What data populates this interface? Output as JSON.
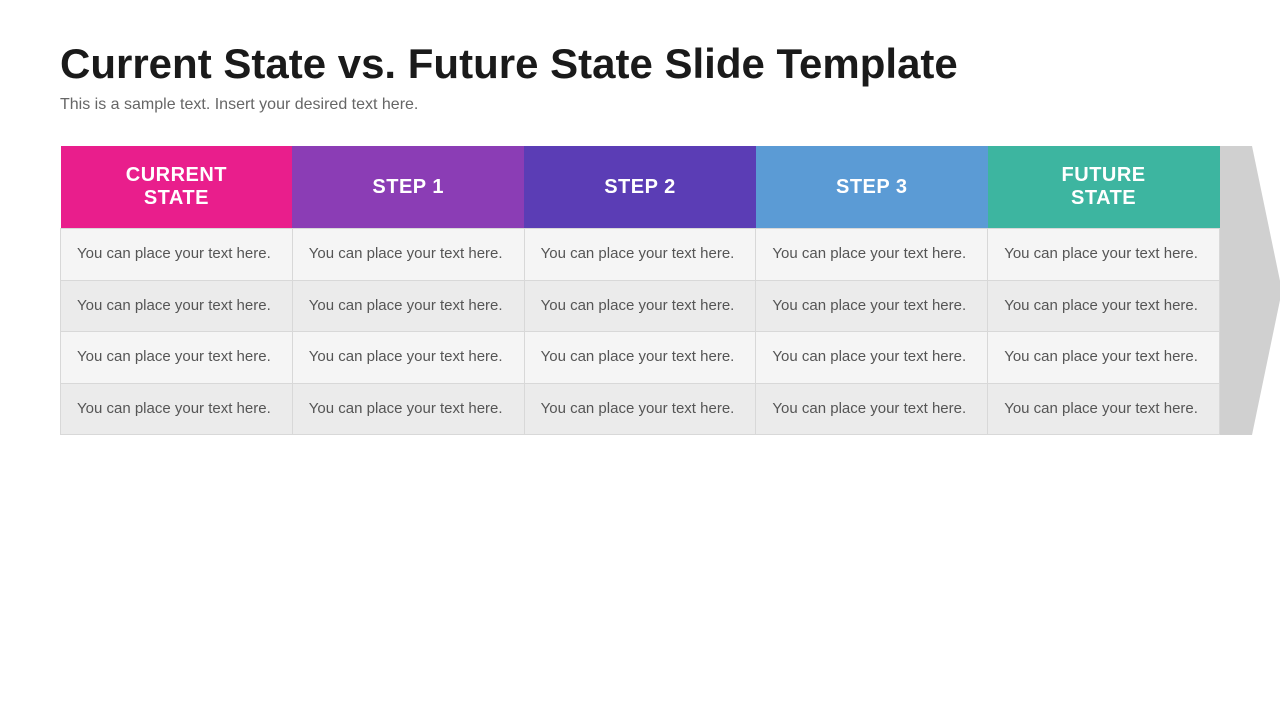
{
  "header": {
    "title": "Current State vs. Future State Slide Template",
    "subtitle": "This is a sample text. Insert your desired text here."
  },
  "table": {
    "columns": [
      {
        "id": "current",
        "label": "CURRENT\nSTATE",
        "class": "col-current"
      },
      {
        "id": "step1",
        "label": "STEP 1",
        "class": "col-step1"
      },
      {
        "id": "step2",
        "label": "STEP 2",
        "class": "col-step2"
      },
      {
        "id": "step3",
        "label": "STEP 3",
        "class": "col-step3"
      },
      {
        "id": "future",
        "label": "FUTURE\nSTATE",
        "class": "col-future"
      }
    ],
    "cell_text": "You can place your text here.",
    "rows": 4
  }
}
